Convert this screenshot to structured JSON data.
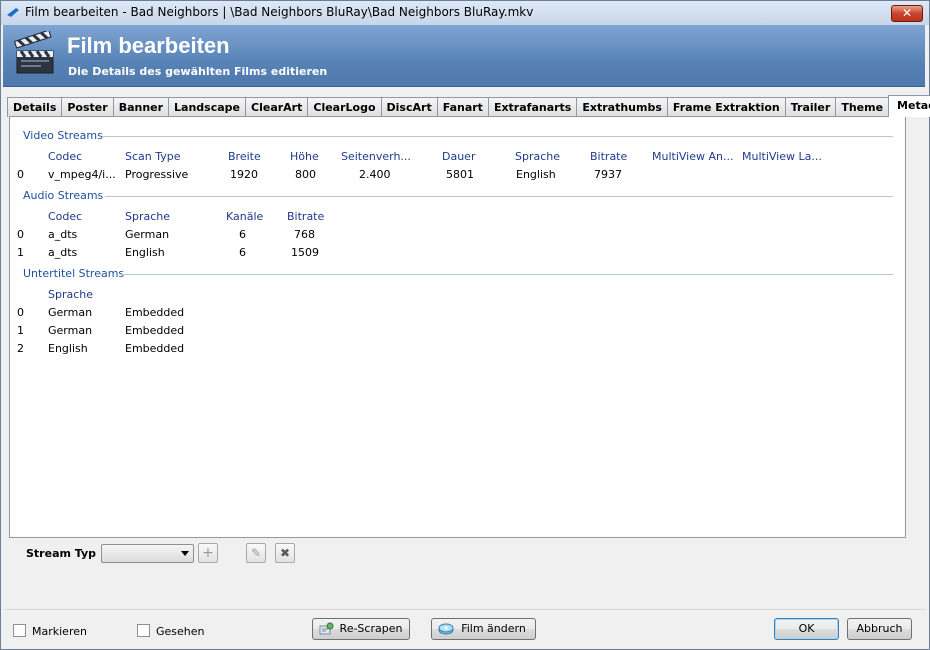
{
  "window": {
    "title": "Film bearbeiten - Bad Neighbors | \\Bad Neighbors BluRay\\Bad Neighbors BluRay.mkv",
    "close_label": "✕"
  },
  "header": {
    "title": "Film bearbeiten",
    "subtitle": "Die Details des gewählten Films editieren"
  },
  "tabs": [
    {
      "label": "Details"
    },
    {
      "label": "Poster"
    },
    {
      "label": "Banner"
    },
    {
      "label": "Landscape"
    },
    {
      "label": "ClearArt"
    },
    {
      "label": "ClearLogo"
    },
    {
      "label": "DiscArt"
    },
    {
      "label": "Fanart"
    },
    {
      "label": "Extrafanarts"
    },
    {
      "label": "Extrathumbs"
    },
    {
      "label": "Frame Extraktion"
    },
    {
      "label": "Trailer"
    },
    {
      "label": "Theme"
    },
    {
      "label": "Metadaten"
    }
  ],
  "active_tab": "Metadaten",
  "video": {
    "header": "Video Streams",
    "columns": [
      "Codec",
      "Scan Type",
      "Breite",
      "Höhe",
      "Seitenverh...",
      "Dauer",
      "Sprache",
      "Bitrate",
      "MultiView An...",
      "MultiView La..."
    ],
    "rows": [
      [
        "0",
        "v_mpeg4/i...",
        "Progressive",
        "1920",
        "800",
        "2.400",
        "5801",
        "English",
        "7937",
        "",
        ""
      ]
    ]
  },
  "audio": {
    "header": "Audio Streams",
    "columns": [
      "Codec",
      "Sprache",
      "Kanäle",
      "Bitrate"
    ],
    "rows": [
      [
        "0",
        "a_dts",
        "German",
        "6",
        "768"
      ],
      [
        "1",
        "a_dts",
        "English",
        "6",
        "1509"
      ]
    ]
  },
  "subtitles": {
    "header": "Untertitel Streams",
    "columns": [
      "Sprache"
    ],
    "rows": [
      [
        "0",
        "German",
        "Embedded"
      ],
      [
        "1",
        "German",
        "Embedded"
      ],
      [
        "2",
        "English",
        "Embedded"
      ]
    ]
  },
  "stream_type": {
    "label": "Stream Typ",
    "value": "",
    "add_label": "+",
    "edit_label": "✎",
    "remove_label": "✖"
  },
  "footer": {
    "markieren_label": "Markieren",
    "gesehen_label": "Gesehen",
    "markieren_checked": false,
    "gesehen_checked": false,
    "rescrape_label": "Re-Scrapen",
    "change_label": "Film ändern",
    "ok_label": "OK",
    "cancel_label": "Abbruch"
  }
}
